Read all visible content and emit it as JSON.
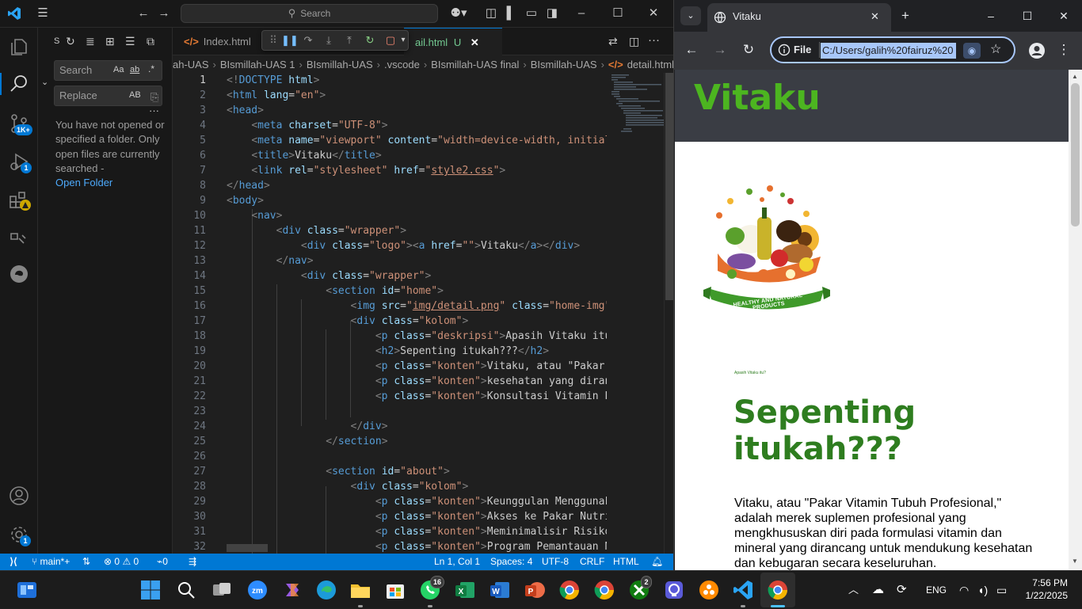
{
  "vscode": {
    "search_label": "Search",
    "sidebar": {
      "title": "S",
      "search_placeholder": "Search",
      "replace_placeholder": "Replace",
      "match_case": "Aa",
      "whole_word": "ab",
      "preserve_case": "AB",
      "message": "You have not opened or specified a folder. Only open files are currently searched -",
      "open_folder": "Open Folder"
    },
    "activity_badges": {
      "source_control": "1K+",
      "run_debug": "1",
      "settings": "1"
    },
    "tabs": [
      {
        "label": "Index.html",
        "active": false
      },
      {
        "label": "ail.html",
        "modified_flag": "U",
        "active": true
      }
    ],
    "breadcrumbs": [
      "ah-UAS",
      "BIsmillah-UAS 1",
      "BIsmillah-UAS",
      ".vscode",
      "BIsmillah-UAS final",
      "BIsmillah-UAS",
      "detail.html"
    ],
    "code_lines": [
      {
        "n": "1",
        "html": "<span class=\"p\">&lt;!</span><span class=\"t\">DOCTYPE</span> <span class=\"a\">html</span><span class=\"p\">&gt;</span>"
      },
      {
        "n": "2",
        "html": "<span class=\"p\">&lt;</span><span class=\"t\">html</span> <span class=\"a\">lang</span>=<span class=\"s\">\"en\"</span><span class=\"p\">&gt;</span>"
      },
      {
        "n": "3",
        "html": "<span class=\"p\">&lt;</span><span class=\"t\">head</span><span class=\"p\">&gt;</span>"
      },
      {
        "n": "4",
        "html": "    <span class=\"p\">&lt;</span><span class=\"t\">meta</span> <span class=\"a\">charset</span>=<span class=\"s\">\"UTF-8\"</span><span class=\"p\">&gt;</span>"
      },
      {
        "n": "5",
        "html": "    <span class=\"p\">&lt;</span><span class=\"t\">meta</span> <span class=\"a\">name</span>=<span class=\"s\">\"viewport\"</span> <span class=\"a\">content</span>=<span class=\"s\">\"width=device-width, initial-</span>"
      },
      {
        "n": "6",
        "html": "    <span class=\"p\">&lt;</span><span class=\"t\">title</span><span class=\"p\">&gt;</span>Vitaku<span class=\"p\">&lt;/</span><span class=\"t\">title</span><span class=\"p\">&gt;</span>"
      },
      {
        "n": "7",
        "html": "    <span class=\"p\">&lt;</span><span class=\"t\">link</span> <span class=\"a\">rel</span>=<span class=\"s\">\"stylesheet\"</span> <span class=\"a\">href</span>=<span class=\"s\">\"<span class=\"u\">style2.css</span>\"</span><span class=\"p\">&gt;</span>"
      },
      {
        "n": "8",
        "html": "<span class=\"p\">&lt;/</span><span class=\"t\">head</span><span class=\"p\">&gt;</span>"
      },
      {
        "n": "9",
        "html": "<span class=\"p\">&lt;</span><span class=\"t\">body</span><span class=\"p\">&gt;</span>"
      },
      {
        "n": "10",
        "html": "    <span class=\"p\">&lt;</span><span class=\"t\">nav</span><span class=\"p\">&gt;</span>"
      },
      {
        "n": "11",
        "html": "        <span class=\"p\">&lt;</span><span class=\"t\">div</span> <span class=\"a\">class</span>=<span class=\"s\">\"wrapper\"</span><span class=\"p\">&gt;</span>"
      },
      {
        "n": "12",
        "html": "            <span class=\"p\">&lt;</span><span class=\"t\">div</span> <span class=\"a\">class</span>=<span class=\"s\">\"logo\"</span><span class=\"p\">&gt;&lt;</span><span class=\"t\">a</span> <span class=\"a\">href</span>=<span class=\"s\">\"\"</span><span class=\"p\">&gt;</span>Vitaku<span class=\"p\">&lt;/</span><span class=\"t\">a</span><span class=\"p\">&gt;&lt;/</span><span class=\"t\">div</span><span class=\"p\">&gt;</span>"
      },
      {
        "n": "13",
        "html": "        <span class=\"p\">&lt;/</span><span class=\"t\">nav</span><span class=\"p\">&gt;</span>"
      },
      {
        "n": "14",
        "html": "            <span class=\"p\">&lt;</span><span class=\"t\">div</span> <span class=\"a\">class</span>=<span class=\"s\">\"wrapper\"</span><span class=\"p\">&gt;</span>"
      },
      {
        "n": "15",
        "html": "                <span class=\"p\">&lt;</span><span class=\"t\">section</span> <span class=\"a\">id</span>=<span class=\"s\">\"home\"</span><span class=\"p\">&gt;</span>"
      },
      {
        "n": "16",
        "html": "                    <span class=\"p\">&lt;</span><span class=\"t\">img</span> <span class=\"a\">src</span>=<span class=\"s\">\"<span class=\"u\">img/detail.png</span>\"</span> <span class=\"a\">class</span>=<span class=\"s\">\"home-img\"</span>"
      },
      {
        "n": "17",
        "html": "                    <span class=\"p\">&lt;</span><span class=\"t\">div</span> <span class=\"a\">class</span>=<span class=\"s\">\"kolom\"</span><span class=\"p\">&gt;</span>"
      },
      {
        "n": "18",
        "html": "                        <span class=\"p\">&lt;</span><span class=\"t\">p</span> <span class=\"a\">class</span>=<span class=\"s\">\"deskripsi\"</span><span class=\"p\">&gt;</span>Apasih Vitaku itu"
      },
      {
        "n": "19",
        "html": "                        <span class=\"p\">&lt;</span><span class=\"t\">h2</span><span class=\"p\">&gt;</span>Sepenting itukah???<span class=\"p\">&lt;/</span><span class=\"t\">h2</span><span class=\"p\">&gt;</span>"
      },
      {
        "n": "20",
        "html": "                        <span class=\"p\">&lt;</span><span class=\"t\">p</span> <span class=\"a\">class</span>=<span class=\"s\">\"konten\"</span><span class=\"p\">&gt;</span>Vitaku, atau \"Pakar V"
      },
      {
        "n": "21",
        "html": "                        <span class=\"p\">&lt;</span><span class=\"t\">p</span> <span class=\"a\">class</span>=<span class=\"s\">\"konten\"</span><span class=\"p\">&gt;</span>kesehatan yang diranc"
      },
      {
        "n": "22",
        "html": "                        <span class=\"p\">&lt;</span><span class=\"t\">p</span> <span class=\"a\">class</span>=<span class=\"s\">\"konten\"</span><span class=\"p\">&gt;</span>Konsultasi Vitamin Pe"
      },
      {
        "n": "23",
        "html": ""
      },
      {
        "n": "24",
        "html": "                    <span class=\"p\">&lt;/</span><span class=\"t\">div</span><span class=\"p\">&gt;</span>"
      },
      {
        "n": "25",
        "html": "                <span class=\"p\">&lt;/</span><span class=\"t\">section</span><span class=\"p\">&gt;</span>"
      },
      {
        "n": "26",
        "html": ""
      },
      {
        "n": "27",
        "html": "                <span class=\"p\">&lt;</span><span class=\"t\">section</span> <span class=\"a\">id</span>=<span class=\"s\">\"about\"</span><span class=\"p\">&gt;</span>"
      },
      {
        "n": "28",
        "html": "                    <span class=\"p\">&lt;</span><span class=\"t\">div</span> <span class=\"a\">class</span>=<span class=\"s\">\"kolom\"</span><span class=\"p\">&gt;</span>"
      },
      {
        "n": "29",
        "html": "                        <span class=\"p\">&lt;</span><span class=\"t\">p</span> <span class=\"a\">class</span>=<span class=\"s\">\"konten\"</span><span class=\"p\">&gt;</span>Keunggulan Menggunaka"
      },
      {
        "n": "30",
        "html": "                        <span class=\"p\">&lt;</span><span class=\"t\">p</span> <span class=\"a\">class</span>=<span class=\"s\">\"konten\"</span><span class=\"p\">&gt;</span>Akses ke Pakar Nutris"
      },
      {
        "n": "31",
        "html": "                        <span class=\"p\">&lt;</span><span class=\"t\">p</span> <span class=\"a\">class</span>=<span class=\"s\">\"konten\"</span><span class=\"p\">&gt;</span>Meminimalisir Risiko"
      },
      {
        "n": "32",
        "html": "                        <span class=\"p\">&lt;</span><span class=\"t\">p</span> <span class=\"a\">class</span>=<span class=\"s\">\"konten\"</span><span class=\"p\">&gt;</span>Program Pemantauan Nu"
      }
    ],
    "status": {
      "branch": "main*+",
      "errors": "0",
      "warnings": "0",
      "ports": "0",
      "cursor": "Ln 1, Col 1",
      "spaces": "Spaces: 4",
      "encoding": "UTF-8",
      "eol": "CRLF",
      "language": "HTML"
    }
  },
  "chrome": {
    "tab_title": "Vitaku",
    "omnibox_scheme": "File",
    "omnibox_url": "C:/Users/galih%20fairuz%20",
    "page": {
      "logo": "Vitaku",
      "banner_text": "HEALTHY AND NATURAL PRODUCTS",
      "small_caption": "Apasih Vitaku itu?",
      "heading": "Sepenting itukah???",
      "body": "Vitaku, atau \"Pakar Vitamin Tubuh Profesional,\" adalah merek suplemen profesional yang mengkhususkan diri pada formulasi vitamin dan mineral yang dirancang untuk mendukung kesehatan dan kebugaran secara keseluruhan."
    }
  },
  "taskbar": {
    "whatsapp_badge": "16",
    "xbox_badge": "2",
    "language": "ENG",
    "time": "7:56 PM",
    "date": "1/22/2025"
  },
  "colors": {
    "vscode_accent": "#0078d4",
    "site_green": "#4cb520",
    "heading_green": "#2e7d1f"
  }
}
